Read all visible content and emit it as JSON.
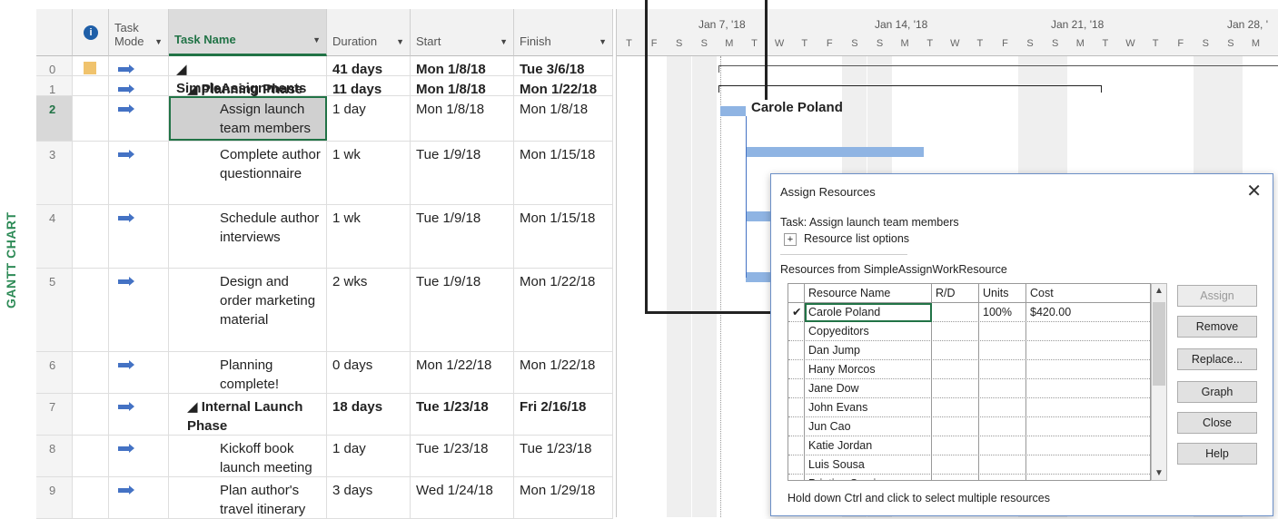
{
  "view_label": "GANTT CHART",
  "columns": {
    "info_icon": "info-icon",
    "task_mode": "Task Mode",
    "task_name": "Task Name",
    "duration": "Duration",
    "start": "Start",
    "finish": "Finish"
  },
  "rows": [
    {
      "id": "0",
      "name": "◢ SimpleAssignments",
      "duration": "41 days",
      "start": "Mon 1/8/18",
      "finish": "Tue 3/6/18",
      "bold": true
    },
    {
      "id": "1",
      "name": "◢ Planning Phase",
      "duration": "11 days",
      "start": "Mon 1/8/18",
      "finish": "Mon 1/22/18",
      "bold": true
    },
    {
      "id": "2",
      "name": "Assign launch team members",
      "duration": "1 day",
      "start": "Mon 1/8/18",
      "finish": "Mon 1/8/18",
      "bold": false
    },
    {
      "id": "3",
      "name": "Complete author questionnaire",
      "duration": "1 wk",
      "start": "Tue 1/9/18",
      "finish": "Mon 1/15/18",
      "bold": false
    },
    {
      "id": "4",
      "name": "Schedule author interviews",
      "duration": "1 wk",
      "start": "Tue 1/9/18",
      "finish": "Mon 1/15/18",
      "bold": false
    },
    {
      "id": "5",
      "name": "Design and order marketing material",
      "duration": "2 wks",
      "start": "Tue 1/9/18",
      "finish": "Mon 1/22/18",
      "bold": false
    },
    {
      "id": "6",
      "name": "Planning complete!",
      "duration": "0 days",
      "start": "Mon 1/22/18",
      "finish": "Mon 1/22/18",
      "bold": false
    },
    {
      "id": "7",
      "name": "◢ Internal Launch Phase",
      "duration": "18 days",
      "start": "Tue 1/23/18",
      "finish": "Fri 2/16/18",
      "bold": true
    },
    {
      "id": "8",
      "name": "Kickoff book launch meeting",
      "duration": "1 day",
      "start": "Tue 1/23/18",
      "finish": "Tue 1/23/18",
      "bold": false
    },
    {
      "id": "9",
      "name": "Plan author's travel itinerary",
      "duration": "3 days",
      "start": "Wed 1/24/18",
      "finish": "Mon 1/29/18",
      "bold": false
    }
  ],
  "timescale": {
    "weeks": [
      "Jan 7, '18",
      "Jan 14, '18",
      "Jan 21, '18",
      "Jan 28, '"
    ],
    "days": [
      "T",
      "F",
      "S",
      "S",
      "M",
      "T",
      "W",
      "T",
      "F",
      "S",
      "S",
      "M",
      "T",
      "W",
      "T",
      "F",
      "S",
      "S",
      "M",
      "T",
      "W",
      "T",
      "F",
      "S",
      "S",
      "M"
    ]
  },
  "gantt_resource_label": "Carole Poland",
  "dialog": {
    "title": "Assign Resources",
    "close": "✕",
    "task_line": "Task: Assign launch team members",
    "options_toggle": "+",
    "options_label": "Resource list options",
    "resources_from": "Resources from SimpleAssignWorkResource",
    "table_headers": {
      "name": "Resource Name",
      "rd": "R/D",
      "units": "Units",
      "cost": "Cost"
    },
    "resources": [
      {
        "check": "✔",
        "name": "Carole Poland",
        "rd": "",
        "units": "100%",
        "cost": "$420.00"
      },
      {
        "check": "",
        "name": "Copyeditors",
        "rd": "",
        "units": "",
        "cost": ""
      },
      {
        "check": "",
        "name": "Dan Jump",
        "rd": "",
        "units": "",
        "cost": ""
      },
      {
        "check": "",
        "name": "Hany Morcos",
        "rd": "",
        "units": "",
        "cost": ""
      },
      {
        "check": "",
        "name": "Jane Dow",
        "rd": "",
        "units": "",
        "cost": ""
      },
      {
        "check": "",
        "name": "John Evans",
        "rd": "",
        "units": "",
        "cost": ""
      },
      {
        "check": "",
        "name": "Jun Cao",
        "rd": "",
        "units": "",
        "cost": ""
      },
      {
        "check": "",
        "name": "Katie Jordan",
        "rd": "",
        "units": "",
        "cost": ""
      },
      {
        "check": "",
        "name": "Luis Sousa",
        "rd": "",
        "units": "",
        "cost": ""
      },
      {
        "check": "",
        "name": "Printing Service",
        "rd": "",
        "units": "",
        "cost": ""
      }
    ],
    "buttons": {
      "assign": "Assign",
      "remove": "Remove",
      "replace": "Replace...",
      "graph": "Graph",
      "close": "Close",
      "help": "Help"
    },
    "hint": "Hold down Ctrl and click to select multiple resources",
    "scroll_up": "▲",
    "scroll_down": "▼"
  }
}
